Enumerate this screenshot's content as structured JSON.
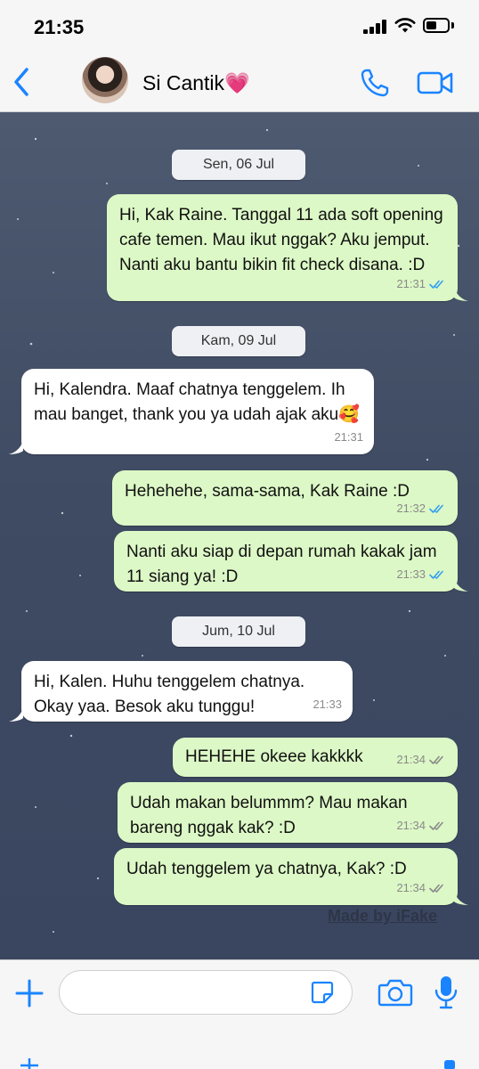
{
  "status_bar": {
    "time": "21:35"
  },
  "header": {
    "contact_name": "Si Cantik💗",
    "icons": [
      "back-chevron-icon",
      "phone-icon",
      "video-camera-icon"
    ]
  },
  "chat": {
    "dates": {
      "d1": "Sen, 06 Jul",
      "d2": "Kam, 09 Jul",
      "d3": "Jum, 10 Jul"
    },
    "messages": {
      "m1": {
        "direction": "out",
        "text": "Hi, Kak Raine. Tanggal 11 ada soft opening cafe temen. Mau ikut nggak? Aku jemput. Nanti aku bantu bikin fit check disana. :D",
        "time": "21:31",
        "status": "read"
      },
      "m2": {
        "direction": "in",
        "text": "Hi, Kalendra. Maaf chatnya tenggelem. Ih mau banget, thank you ya udah ajak aku🥰",
        "time": "21:31"
      },
      "m3": {
        "direction": "out",
        "text": "Hehehehe, sama-sama, Kak Raine :D",
        "time": "21:32",
        "status": "read"
      },
      "m4": {
        "direction": "out",
        "text": "Nanti aku siap di depan rumah kakak jam 11 siang ya! :D",
        "time": "21:33",
        "status": "read"
      },
      "m5": {
        "direction": "in",
        "text": "Hi, Kalen. Huhu tenggelem chatnya. Okay yaa. Besok aku tunggu!",
        "time": "21:33"
      },
      "m6": {
        "direction": "out",
        "text": "HEHEHE okeee kakkkk",
        "time": "21:34",
        "status": "delivered"
      },
      "m7": {
        "direction": "out",
        "text": "Udah makan belummm? Mau makan bareng nggak kak? :D",
        "time": "21:34",
        "status": "delivered"
      },
      "m8": {
        "direction": "out",
        "text": "Udah tenggelem ya chatnya, Kak? :D",
        "time": "21:34",
        "status": "delivered"
      }
    },
    "watermark": "Made by iFake"
  },
  "input_bar": {
    "value": "",
    "icons": [
      "plus-icon",
      "sticker-icon",
      "camera-icon",
      "microphone-icon"
    ]
  },
  "colors": {
    "accent": "#1a84ff",
    "outgoing_bubble": "#dcf8c6",
    "incoming_bubble": "#ffffff",
    "read_tick": "#34a0f0",
    "delivered_tick": "#8a8a8a",
    "chat_background": "#3f4b62"
  }
}
